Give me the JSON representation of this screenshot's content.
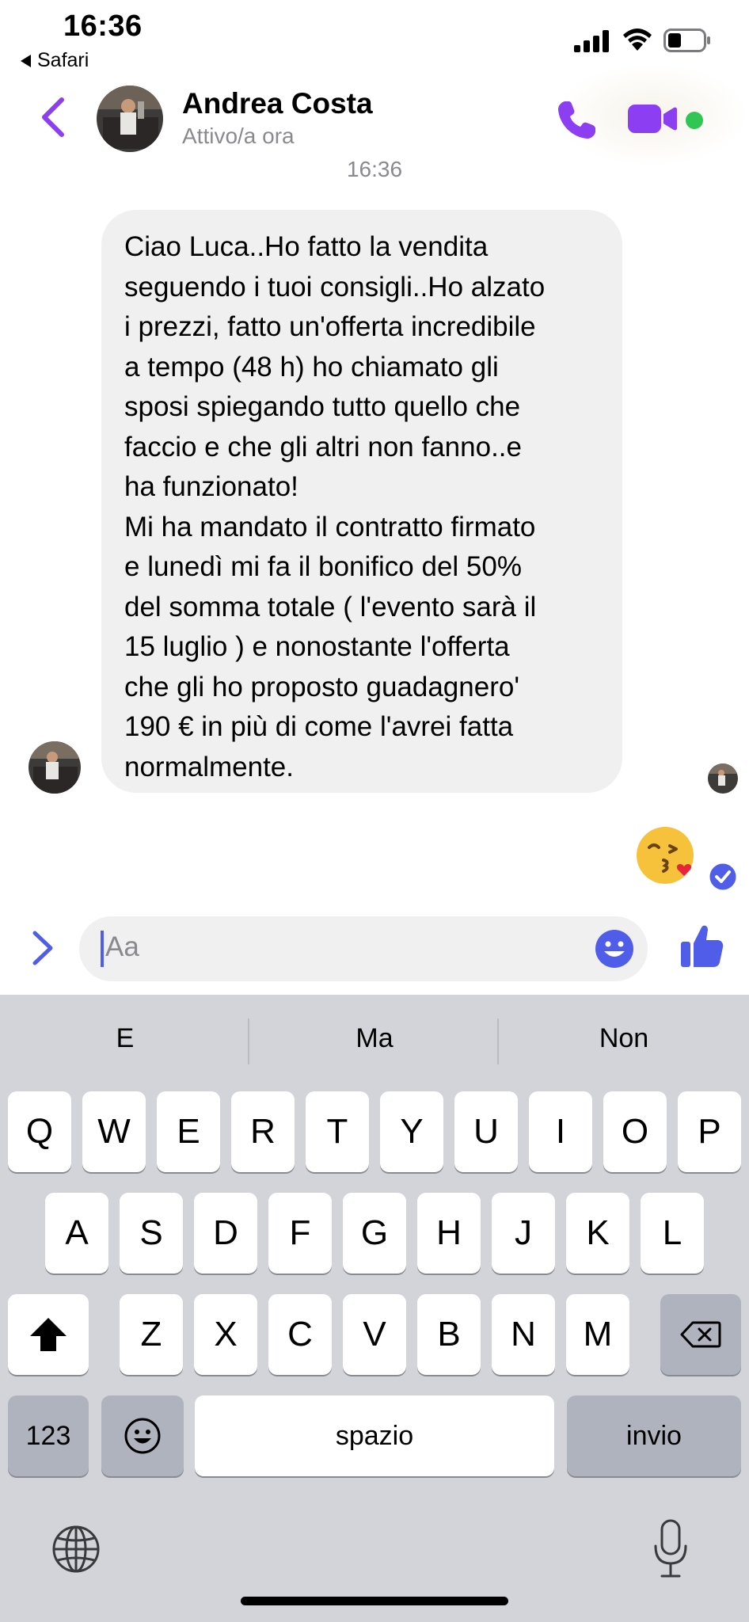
{
  "status_bar": {
    "time": "16:36",
    "back_app": "Safari"
  },
  "header": {
    "contact_name": "Andrea Costa",
    "contact_status": "Attivo/a ora",
    "icons": [
      "back-chevron-icon",
      "phone-icon",
      "video-camera-icon"
    ]
  },
  "thread": {
    "timestamp": "16:36",
    "messages": [
      {
        "from": "contact",
        "text": "Ciao Luca..Ho fatto la vendita\nseguendo i tuoi consigli..Ho alzato\ni prezzi, fatto un'offerta incredibile\na tempo (48 h) ho chiamato gli\nsposi spiegando tutto quello che\nfaccio e che gli altri non fanno..e\nha funzionato!\nMi ha mandato il contratto firmato\ne lunedì mi fa il bonifico del 50%\ndel somma totale ( l'evento sarà il\n15 luglio ) e nonostante l'offerta\nche gli ho proposto guadagnero'\n190 € in più di come l'avrei fatta\nnormalmente."
      },
      {
        "from": "me",
        "emoji": "😘"
      }
    ]
  },
  "composer": {
    "placeholder": "Aa"
  },
  "keyboard": {
    "suggestions": [
      "E",
      "Ma",
      "Non"
    ],
    "row1": [
      "Q",
      "W",
      "E",
      "R",
      "T",
      "Y",
      "U",
      "I",
      "O",
      "P"
    ],
    "row2": [
      "A",
      "S",
      "D",
      "F",
      "G",
      "H",
      "J",
      "K",
      "L"
    ],
    "row3": [
      "Z",
      "X",
      "C",
      "V",
      "B",
      "N",
      "M"
    ],
    "numbers_label": "123",
    "space_label": "spazio",
    "return_label": "invio"
  },
  "colors": {
    "accent": "#8b3ef2",
    "accent_blue": "#4f5de9",
    "online": "#31c653",
    "bubble_bg": "#f0f0f0",
    "keyboard_bg": "#d2d4da"
  }
}
